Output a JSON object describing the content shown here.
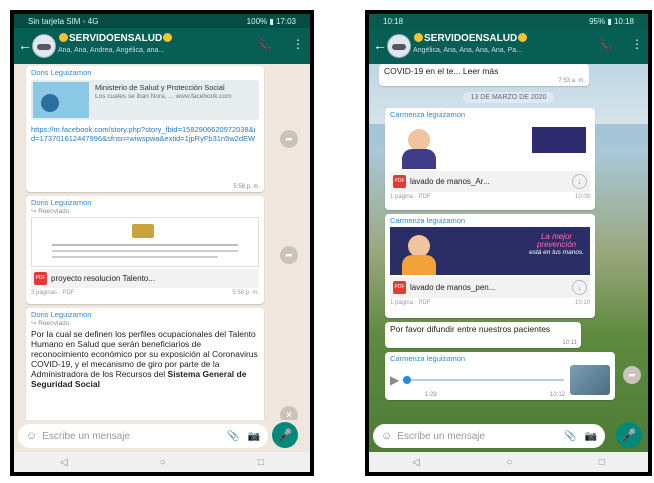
{
  "left": {
    "status_left": "Sin tarjeta SIM ◦ 4G",
    "status_right": "100% ▮ 17:03",
    "contact_name": "SERVIDOENSALUD",
    "participants": "Ana, Ana, Andrea, Angélica, ana...",
    "msg1": {
      "sender": "Doris Leguizamon",
      "preview_title": "Ministerio de Salud y Protección Social",
      "preview_desc": "Los cuales se iban Nora, ... www.facebook.com",
      "url": "https://m.facebook.com/story.php?story_fbid=1582906620972038&id=173701612447996&sfnsn=wiwspwa&extid=1jpRyFb31n5w2dEW",
      "time": "5:58 p. m."
    },
    "msg2": {
      "sender": "Doris Leguizamon",
      "forwarded": "↪ Reenviado",
      "filename": "proyecto resolucion Talento...",
      "meta_left": "3 páginas · PDF",
      "time": "5:58 p. m."
    },
    "msg3": {
      "sender": "Doris Leguizamon",
      "forwarded": "↪ Reenviado",
      "text_a": "Por la cual se definen los perfiles ocupacionales del Talento Humano en Salud que serán beneficiarios de reconocimiento económico por su exposición al Coronavirus COVID-19, y el mecanismo de giro por parte de la Administradora de los Recursos del ",
      "text_b": "Sistema General de Seguridad Social"
    },
    "input_placeholder": "Escribe un mensaje"
  },
  "right": {
    "status_left": "10:18",
    "status_right": "95% ▮ 10:18",
    "contact_name": "SERVIDOENSALUD",
    "participants": "Angélica, Ana, Ana, Ana, Ana, Pa...",
    "top_text": "COVID-19 en el te... Leer más",
    "top_time": "7:53 a. m.",
    "date_chip": "13 DE MARZO DE 2020",
    "msg1": {
      "sender": "Carmenza leguizamon",
      "filename": "lavado de manos_Ar...",
      "meta_left": "1 página · PDF",
      "time": "10:09"
    },
    "msg2": {
      "sender": "Carmenza leguizamon",
      "slogan_a": "La mejor",
      "slogan_b": "prevención",
      "slogan_c": "está en tus manos.",
      "filename": "lavado de manos_pen...",
      "meta_left": "1 página · PDF",
      "time": "10:10"
    },
    "msg3": {
      "text": "Por favor difundir entre nuestros pacientes",
      "time": "10:11"
    },
    "msg4": {
      "sender": "Carmenza leguizamon",
      "duration": "1:29",
      "time": "10:12"
    },
    "input_placeholder": "Escribe un mensaje"
  }
}
